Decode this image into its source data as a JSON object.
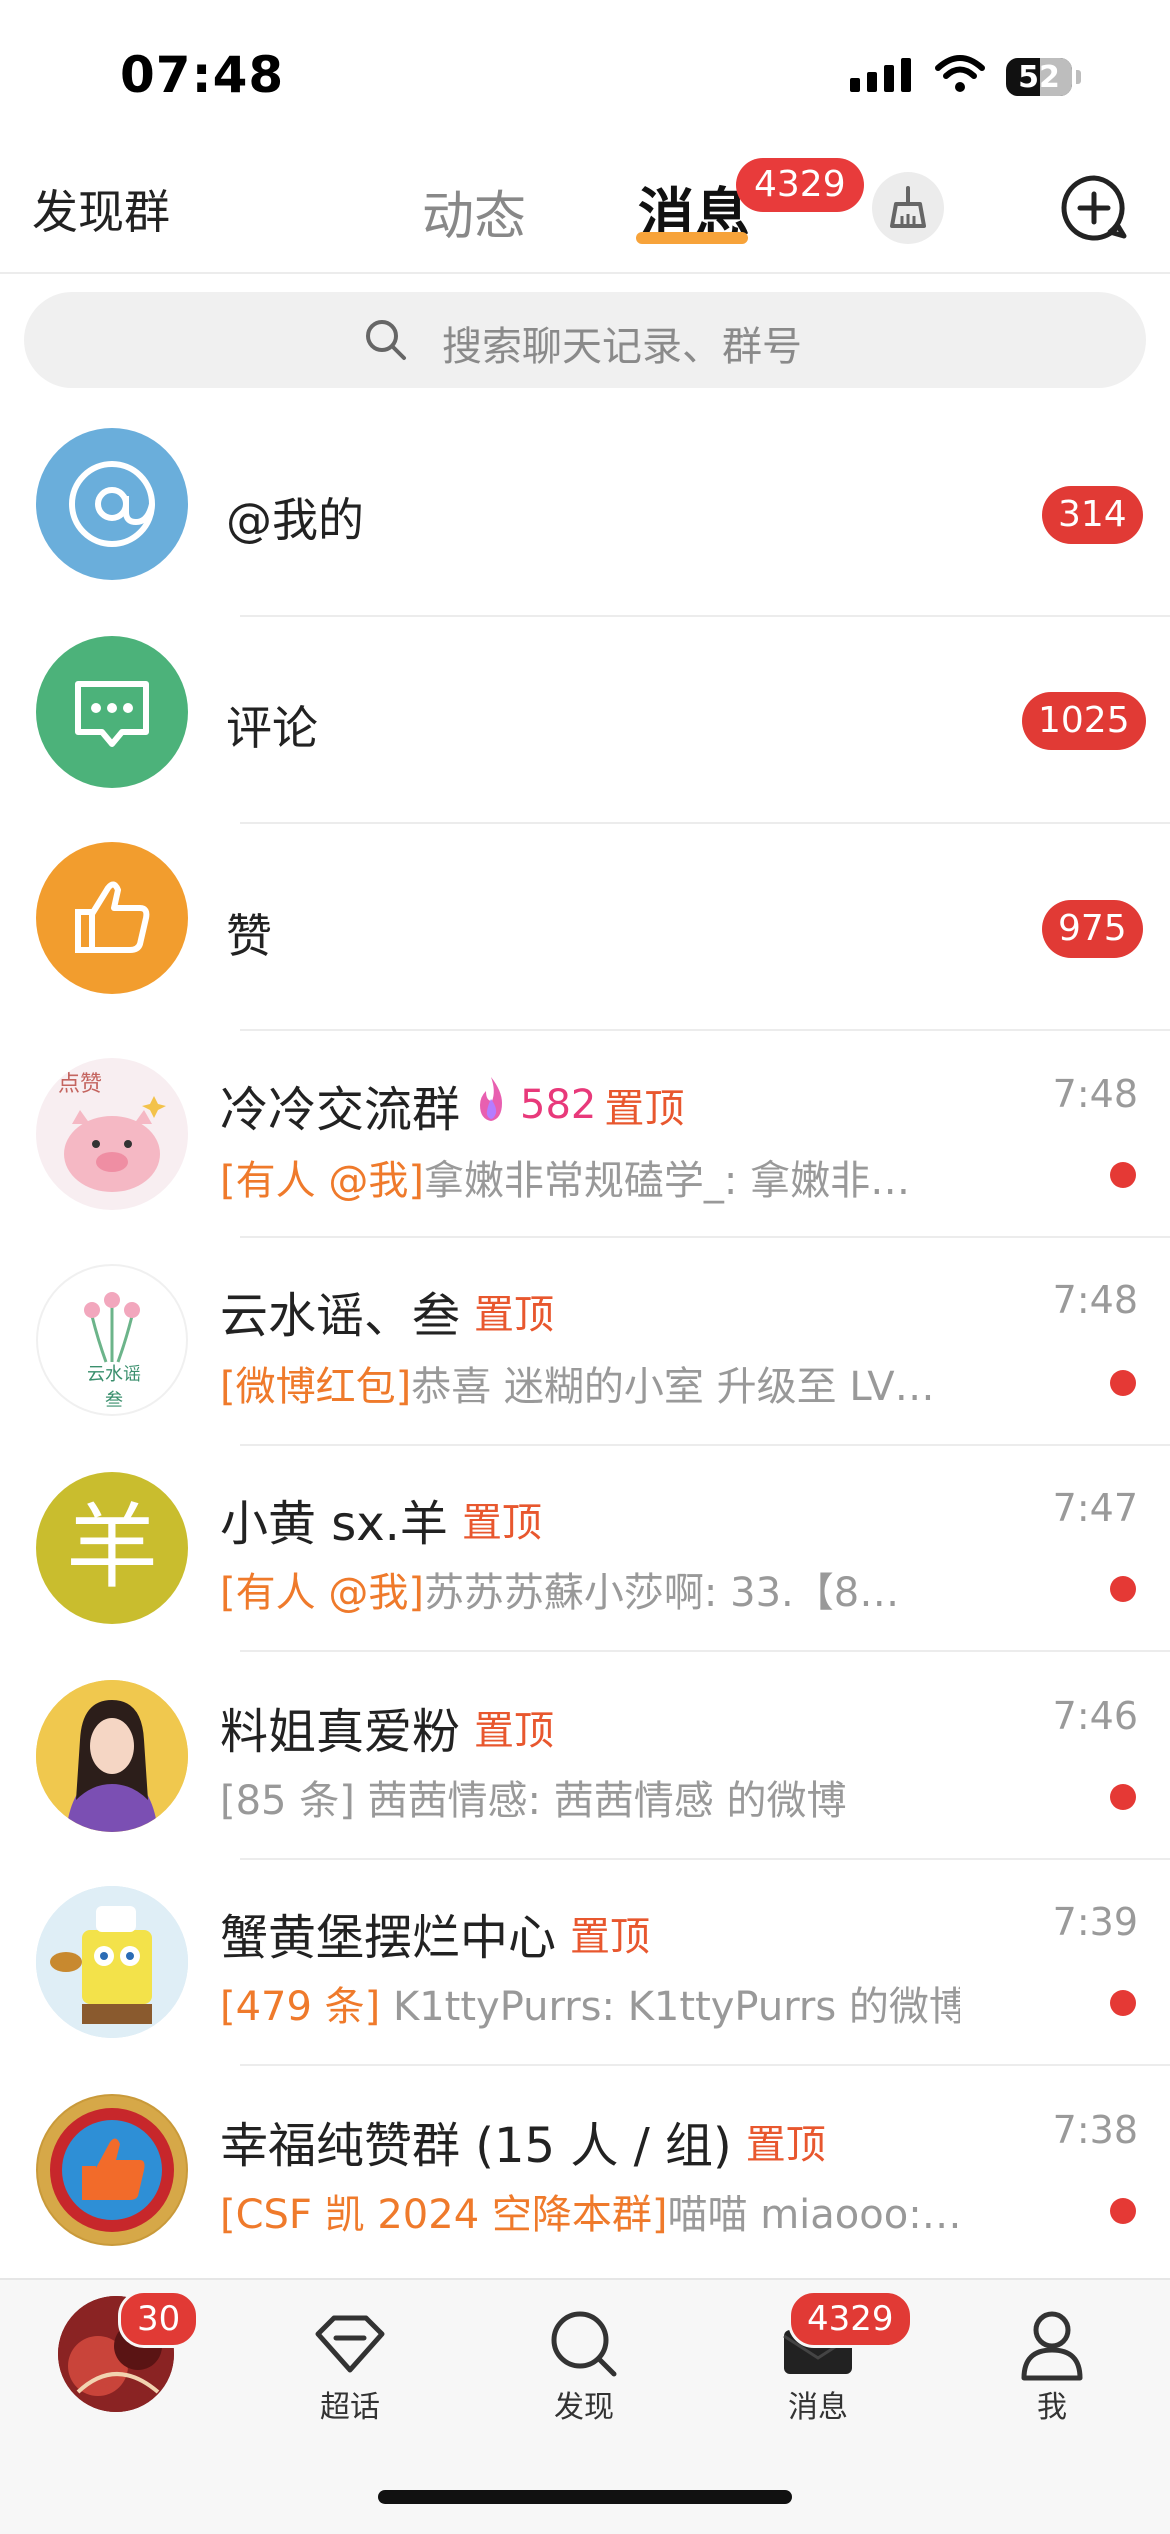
{
  "status_bar": {
    "time": "07:48",
    "battery": "52"
  },
  "nav": {
    "discover_groups": "发现群",
    "tab_dynamic": "动态",
    "tab_messages": "消息",
    "messages_badge": "4329"
  },
  "search": {
    "placeholder": "搜索聊天记录、群号"
  },
  "system_rows": [
    {
      "label": "@我的",
      "count": "314",
      "color": "#6aaedb",
      "icon": "at-icon"
    },
    {
      "label": "评论",
      "count": "1025",
      "color": "#4cb27a",
      "icon": "comment-icon"
    },
    {
      "label": "赞",
      "count": "975",
      "color": "#f29d2e",
      "icon": "thumbs-up-icon"
    }
  ],
  "chats": [
    {
      "title": "冷冷交流群",
      "fire_count": "582",
      "pin": "置顶",
      "time": "7:48",
      "tag": "[有人 @我]",
      "preview": "拿嫩非常规磕学_: 拿嫩非…",
      "avatar_text": "点赞"
    },
    {
      "title": "云水谣、叁",
      "pin": "置顶",
      "time": "7:48",
      "tag": "[微博红包]",
      "preview": "恭喜 迷糊的小室 升级至 LV…",
      "avatar_text": "云水谣 叁"
    },
    {
      "title": "小黄 sx.羊",
      "pin": "置顶",
      "time": "7:47",
      "tag": "[有人 @我]",
      "preview": "苏苏苏蘇小莎啊: 33.【8…",
      "avatar_text": "羊"
    },
    {
      "title": "料姐真爱粉",
      "pin": "置顶",
      "time": "7:46",
      "tag": "",
      "preview": "[85 条] 茜茜情感: 茜茜情感 的微博"
    },
    {
      "title": "蟹黄堡摆烂中心",
      "pin": "置顶",
      "time": "7:39",
      "tag": "[479 条]",
      "preview": " K1ttyPurrs: K1ttyPurrs 的微博"
    },
    {
      "title": "幸福纯赞群 (15 人 / 组)",
      "pin": "置顶",
      "time": "7:38",
      "tag": "[CSF 凯 2024 空降本群]",
      "preview": "喵喵 miaooo:…"
    }
  ],
  "tabbar": {
    "profile_badge": "30",
    "supertopic": "超话",
    "discover": "发现",
    "messages": "消息",
    "messages_badge": "4329",
    "me": "我"
  },
  "colors": {
    "accent": "#f7a33a",
    "badge": "#e13a35",
    "pin": "#e8572e",
    "tag": "#ef7a2b"
  }
}
